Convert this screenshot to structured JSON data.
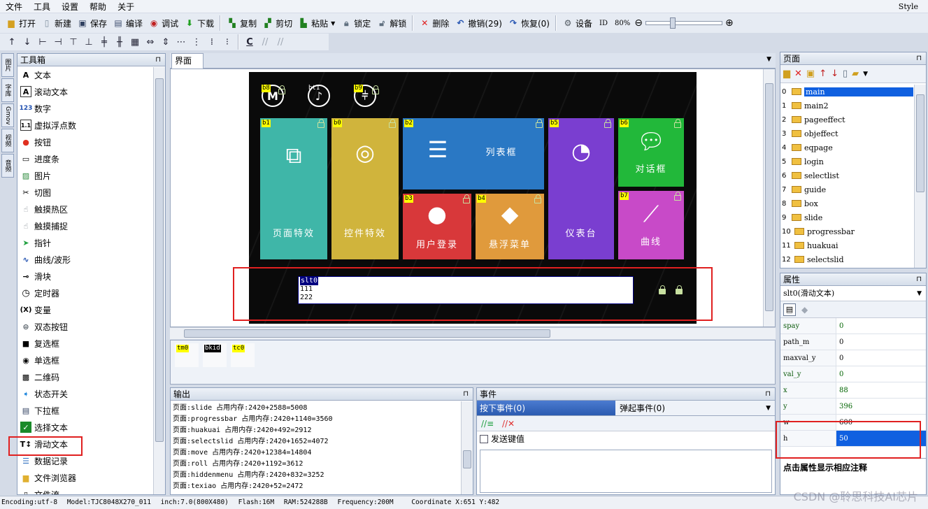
{
  "menu": {
    "items": [
      "文件",
      "工具",
      "设置",
      "帮助",
      "关于"
    ],
    "style": "Style"
  },
  "toolbar": {
    "buttons": [
      {
        "label": "打开",
        "icon": "folder-open-icon"
      },
      {
        "label": "新建",
        "icon": "new-file-icon"
      },
      {
        "label": "保存",
        "icon": "save-icon"
      },
      {
        "label": "编译",
        "icon": "compile-icon"
      },
      {
        "label": "调试",
        "icon": "debug-icon"
      },
      {
        "label": "下载",
        "icon": "download-icon"
      },
      {
        "label": "复制",
        "icon": "copy-icon"
      },
      {
        "label": "剪切",
        "icon": "cut-icon"
      },
      {
        "label": "粘贴",
        "icon": "paste-icon"
      },
      {
        "label": "锁定",
        "icon": "lock-icon"
      },
      {
        "label": "解锁",
        "icon": "unlock-icon"
      },
      {
        "label": "删除",
        "icon": "delete-icon"
      },
      {
        "label": "撤销(29)",
        "icon": "undo-icon"
      },
      {
        "label": "恢复(0)",
        "icon": "redo-icon"
      },
      {
        "label": "设备",
        "icon": "gear-icon"
      }
    ],
    "id_label": "ID",
    "zoom": "80%",
    "zoom_fraction": 0.33
  },
  "side_tabs": [
    "图片",
    "字库",
    "Gmov",
    "视频",
    "音频"
  ],
  "toolbox": {
    "title": "工具箱",
    "items": [
      "文本",
      "滚动文本",
      "数字",
      "虚拟浮点数",
      "按钮",
      "进度条",
      "图片",
      "切图",
      "触摸热区",
      "触摸捕捉",
      "指针",
      "曲线/波形",
      "滑块",
      "定时器",
      "变量",
      "双态按钮",
      "复选框",
      "单选框",
      "二维码",
      "状态开关",
      "下拉框",
      "选择文本",
      "滑动文本",
      "数据记录",
      "文件浏览器",
      "文件流"
    ]
  },
  "canvas": {
    "tab": "界面",
    "top_icons": [
      {
        "tag": "b8",
        "glyph": "M"
      },
      {
        "tag": "bt1",
        "glyph": "♪"
      },
      {
        "tag": "b9",
        "glyph": "⫩"
      }
    ],
    "tiles": [
      {
        "tag": "b1",
        "label": "页面特效",
        "color": "#3fb6a8"
      },
      {
        "tag": "b0",
        "label": "控件特效",
        "color": "#d0b43c"
      },
      {
        "tag": "b2",
        "label": "列表框",
        "color": "#2a78c4"
      },
      {
        "tag": "b3",
        "label": "用户登录",
        "color": "#d8383a"
      },
      {
        "tag": "b4",
        "label": "悬浮菜单",
        "color": "#e09a3c"
      },
      {
        "tag": "b5",
        "label": "仪表台",
        "color": "#7a3ed0"
      },
      {
        "tag": "b6",
        "label": "对话框",
        "color": "#22b83a"
      },
      {
        "tag": "b7",
        "label": "曲线",
        "color": "#c84ac8"
      }
    ],
    "slider_text": {
      "lines": [
        "slt0",
        "111",
        "222"
      ]
    }
  },
  "components": [
    "tm0",
    "bkid",
    "tc0"
  ],
  "output": {
    "title": "输出",
    "lines": [
      "页面:slide 占用内存:2420+2588=5008",
      "页面:progressbar 占用内存:2420+1140=3560",
      "页面:huakuai 占用内存:2420+492=2912",
      "页面:selectslid 占用内存:2420+1652=4072",
      "页面:move 占用内存:2420+12384=14804",
      "页面:roll 占用内存:2420+1192=3612",
      "页面:hiddenmenu 占用内存:2420+832=3252",
      "页面:texiao 占用内存:2420+52=2472"
    ]
  },
  "events": {
    "title": "事件",
    "tab_press": "按下事件(0)",
    "tab_release": "弹起事件(0)",
    "send_key": "发送键值"
  },
  "pages": {
    "title": "页面",
    "items": [
      "main",
      "main2",
      "pageeffect",
      "objeffect",
      "eqpage",
      "login",
      "selectlist",
      "guide",
      "box",
      "slide",
      "progressbar",
      "huakuai",
      "selectslid"
    ]
  },
  "properties": {
    "title": "属性",
    "selected": "slt0(滑动文本)",
    "rows": [
      {
        "k": "spay",
        "v": "0"
      },
      {
        "k": "path_m",
        "v": "0"
      },
      {
        "k": "maxval_y",
        "v": "0"
      },
      {
        "k": "val_y",
        "v": "0"
      },
      {
        "k": "x",
        "v": "88"
      },
      {
        "k": "y",
        "v": "396"
      },
      {
        "k": "w",
        "v": "600"
      },
      {
        "k": "h",
        "v": "50"
      }
    ],
    "hint": "点击属性显示相应注释"
  },
  "status": {
    "encoding": "Encoding:utf-8",
    "model": "Model:TJC8048X270_011",
    "inch": "inch:7.0(800X480)",
    "flash": "Flash:16M",
    "ram": "RAM:524288B",
    "freq": "Frequency:200M",
    "coord": "Coordinate X:651  Y:482",
    "watermark": "CSDN @聆思科技AI芯片"
  }
}
